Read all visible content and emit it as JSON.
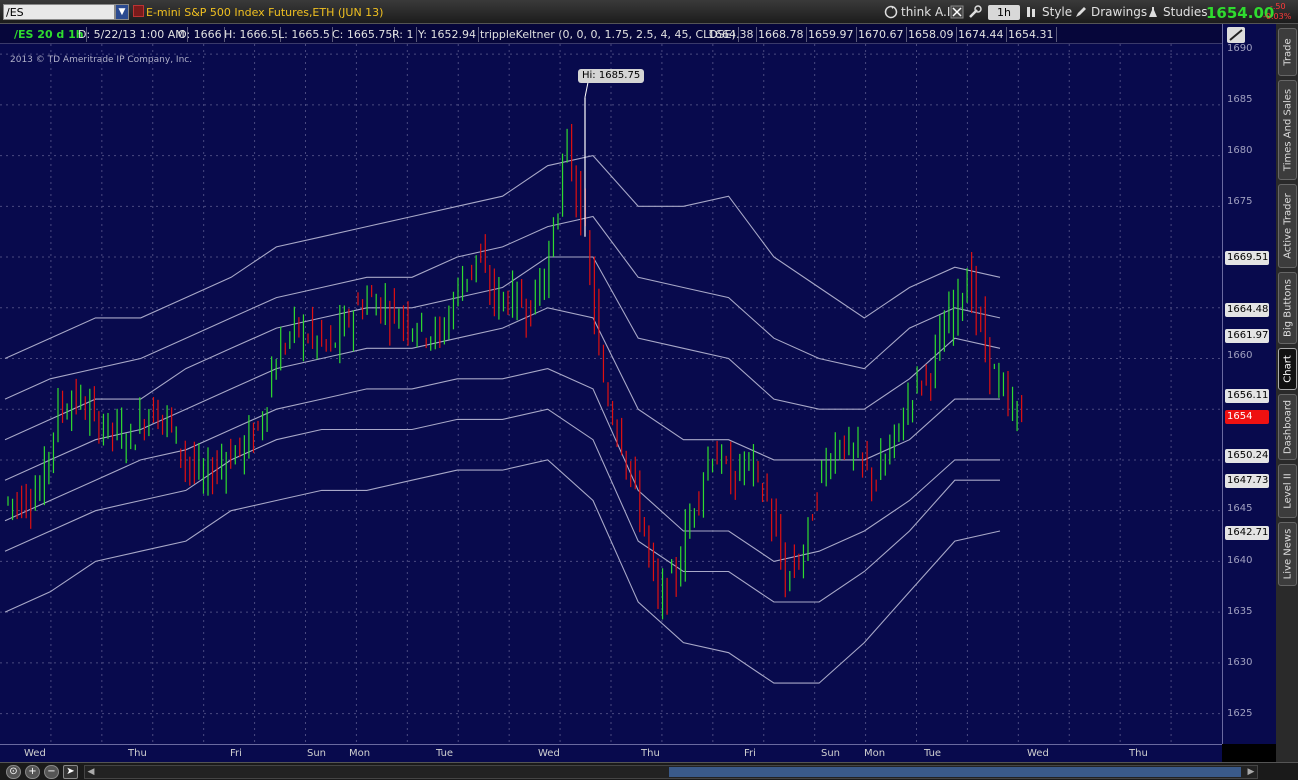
{
  "toolbar": {
    "symbol": "/ES",
    "description": "E-mini S&P 500 Index Futures,ETH (JUN 13)",
    "think_ai": "think A.I.",
    "period": "1h",
    "style": "Style",
    "drawings": "Drawings",
    "studies": "Studies",
    "last_price": "1654.00",
    "change": "-.50",
    "change_pct": "-0.03%"
  },
  "header": {
    "symbol_period": "/ES 20 d 1h",
    "date": "D: 5/22/13 1:00 AM",
    "open": "O: 1666",
    "high": "H: 1666.5",
    "low": "L: 1665.5",
    "close": "C: 1665.75",
    "range": "R: 1",
    "y_value": "Y: 1652.94",
    "study": "trippleKeltner (0, 0, 0, 1.75, 2.5, 4, 45, CLOSE)",
    "study_values": [
      "1664.38",
      "1668.78",
      "1659.97",
      "1670.67",
      "1658.09",
      "1674.44",
      "1654.31"
    ]
  },
  "chart": {
    "copyright": "2013 © TD Ameritrade IP Company, Inc.",
    "hi_label": "Hi: 1685.75",
    "x_labels": [
      "Wed",
      "Thu",
      "Fri",
      "Sun",
      "Mon",
      "Tue",
      "Wed",
      "Thu",
      "Fri",
      "Sun",
      "Mon",
      "Tue",
      "Wed",
      "Thu"
    ],
    "y_ticks": [
      "1690",
      "1685",
      "1680",
      "1675",
      "1660",
      "1645",
      "1640",
      "1635",
      "1630",
      "1625"
    ],
    "value_badges": [
      "1669.51",
      "1664.48",
      "1661.97",
      "1656.11",
      "1654",
      "1650.24",
      "1647.73",
      "1642.71"
    ]
  },
  "colors": {
    "chart_bg": "#080a4d",
    "up_bar": "#2fdc2f",
    "down_bar": "#e01010",
    "band_line": "#a8a8c8",
    "price_up": "#2fdc2f",
    "price_down": "#ff3a3a"
  },
  "sidebar": {
    "tabs": [
      "Trade",
      "Times And Sales",
      "Active Trader",
      "Big Buttons",
      "Chart",
      "Dashboard",
      "Level II",
      "Live News"
    ],
    "active": "Chart"
  },
  "chart_data": {
    "type": "candlestick",
    "title": "/ES 20 d 1h",
    "ylim": [
      1622,
      1691
    ],
    "grid": true,
    "series": [
      {
        "name": "price",
        "values": [
          1646,
          1647,
          1655,
          1656,
          1654,
          1653,
          1652,
          1655,
          1654,
          1650,
          1648,
          1650,
          1651,
          1653,
          1660,
          1663,
          1662,
          1661,
          1664,
          1666,
          1665,
          1664,
          1663,
          1662,
          1667,
          1670,
          1666,
          1666,
          1665,
          1670,
          1681,
          1672,
          1657,
          1652,
          1645,
          1636,
          1639,
          1646,
          1651,
          1648,
          1650,
          1646,
          1638,
          1641,
          1649,
          1652,
          1650,
          1648,
          1652,
          1657,
          1659,
          1664,
          1668,
          1661,
          1656,
          1654
        ]
      },
      {
        "name": "keltner-upper-3",
        "values": [
          1660,
          1662,
          1664,
          1664,
          1666,
          1668,
          1671,
          1672,
          1673,
          1674,
          1675,
          1676,
          1679,
          1680,
          1675,
          1675,
          1676,
          1670,
          1667,
          1664,
          1667,
          1669,
          1668
        ]
      },
      {
        "name": "keltner-upper-2",
        "values": [
          1656,
          1658,
          1659,
          1660,
          1662,
          1664,
          1666,
          1667,
          1668,
          1668,
          1670,
          1671,
          1673,
          1674,
          1668,
          1667,
          1666,
          1662,
          1660,
          1659,
          1663,
          1665,
          1664
        ]
      },
      {
        "name": "keltner-upper-1",
        "values": [
          1652,
          1654,
          1656,
          1656,
          1659,
          1661,
          1663,
          1664,
          1665,
          1665,
          1666,
          1667,
          1670,
          1670,
          1662,
          1661,
          1660,
          1656,
          1655,
          1655,
          1658,
          1662,
          1661
        ]
      },
      {
        "name": "keltner-mid",
        "values": [
          1648,
          1650,
          1652,
          1653,
          1655,
          1657,
          1659,
          1660,
          1661,
          1661,
          1662,
          1663,
          1665,
          1664,
          1655,
          1652,
          1652,
          1650,
          1650,
          1650,
          1652,
          1656,
          1656
        ]
      },
      {
        "name": "keltner-lower-1",
        "values": [
          1644,
          1646,
          1648,
          1650,
          1651,
          1653,
          1655,
          1656,
          1657,
          1657,
          1658,
          1658,
          1659,
          1657,
          1647,
          1643,
          1643,
          1640,
          1641,
          1643,
          1646,
          1650,
          1650
        ]
      },
      {
        "name": "keltner-lower-2",
        "values": [
          1641,
          1643,
          1645,
          1646,
          1647,
          1650,
          1652,
          1653,
          1653,
          1653,
          1654,
          1654,
          1655,
          1652,
          1642,
          1639,
          1639,
          1636,
          1636,
          1639,
          1643,
          1648,
          1648
        ]
      },
      {
        "name": "keltner-lower-3",
        "values": [
          1635,
          1637,
          1640,
          1641,
          1642,
          1645,
          1646,
          1647,
          1647,
          1648,
          1649,
          1649,
          1650,
          1646,
          1636,
          1632,
          1631,
          1628,
          1628,
          1632,
          1637,
          1642,
          1643
        ]
      }
    ]
  }
}
